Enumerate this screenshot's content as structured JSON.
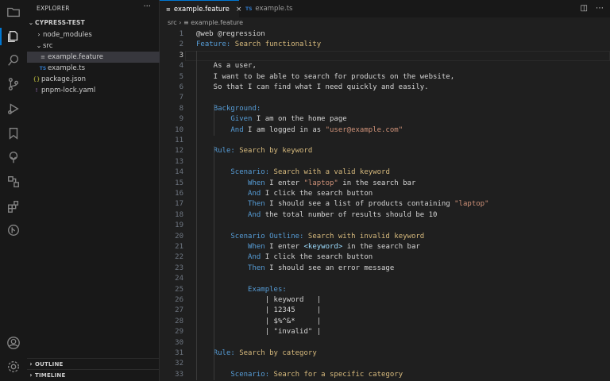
{
  "sidebar": {
    "title": "EXPLORER",
    "more": "···",
    "project": "CYPRESS-TEST",
    "tree": [
      {
        "name": "node_modules",
        "kind": "folder",
        "depth": 1,
        "icon": "chevron-right-icon"
      },
      {
        "name": "src",
        "kind": "folder-open",
        "depth": 1,
        "icon": "chevron-down-icon"
      },
      {
        "name": "example.feature",
        "kind": "feature",
        "depth": 2,
        "icon": "feature-file-icon",
        "selected": true
      },
      {
        "name": "example.ts",
        "kind": "ts",
        "depth": 2,
        "icon": "ts-file-icon"
      },
      {
        "name": "package.json",
        "kind": "json",
        "depth": 1,
        "icon": "json-file-icon"
      },
      {
        "name": "pnpm-lock.yaml",
        "kind": "yaml",
        "depth": 1,
        "icon": "yaml-file-icon"
      }
    ],
    "outline": "OUTLINE",
    "timeline": "TIMELINE"
  },
  "tabs": [
    {
      "label": "example.feature",
      "active": true,
      "icon": "≡",
      "close": "×"
    },
    {
      "label": "example.ts",
      "active": false,
      "icon": "TS"
    }
  ],
  "breadcrumb": {
    "root": "src",
    "separator": "›",
    "icon": "≡",
    "file": "example.feature"
  },
  "editor": {
    "current_line": 3,
    "lines": [
      [
        [
          "@web @regression",
          "k-txt"
        ]
      ],
      [
        [
          "Feature:",
          "k-kw"
        ],
        [
          " Search functionality",
          "k-key"
        ]
      ],
      [],
      [
        [
          "    As a user,",
          "k-txt"
        ]
      ],
      [
        [
          "    I want to be able to search for products on the website,",
          "k-txt"
        ]
      ],
      [
        [
          "    So that I can find what I need quickly and easily.",
          "k-txt"
        ]
      ],
      [],
      [
        [
          "    ",
          "k-txt"
        ],
        [
          "Background:",
          "k-kw"
        ]
      ],
      [
        [
          "        ",
          "k-txt"
        ],
        [
          "Given",
          "k-kw"
        ],
        [
          " I am on the home page",
          "k-txt"
        ]
      ],
      [
        [
          "        ",
          "k-txt"
        ],
        [
          "And",
          "k-kw"
        ],
        [
          " I am logged in as ",
          "k-txt"
        ],
        [
          "\"user@example.com\"",
          "k-str"
        ]
      ],
      [],
      [
        [
          "    ",
          "k-txt"
        ],
        [
          "Rule:",
          "k-kw"
        ],
        [
          " Search by keyword",
          "k-key"
        ]
      ],
      [],
      [
        [
          "        ",
          "k-txt"
        ],
        [
          "Scenario:",
          "k-kw"
        ],
        [
          " Search with a valid keyword",
          "k-key"
        ]
      ],
      [
        [
          "            ",
          "k-txt"
        ],
        [
          "When",
          "k-kw"
        ],
        [
          " I enter ",
          "k-txt"
        ],
        [
          "\"laptop\"",
          "k-str"
        ],
        [
          " in the search bar",
          "k-txt"
        ]
      ],
      [
        [
          "            ",
          "k-txt"
        ],
        [
          "And",
          "k-kw"
        ],
        [
          " I click the search button",
          "k-txt"
        ]
      ],
      [
        [
          "            ",
          "k-txt"
        ],
        [
          "Then",
          "k-kw"
        ],
        [
          " I should see a list of products containing ",
          "k-txt"
        ],
        [
          "\"laptop\"",
          "k-str"
        ]
      ],
      [
        [
          "            ",
          "k-txt"
        ],
        [
          "And",
          "k-kw"
        ],
        [
          " the total number of results should be 10",
          "k-txt"
        ]
      ],
      [],
      [
        [
          "        ",
          "k-txt"
        ],
        [
          "Scenario Outline:",
          "k-kw"
        ],
        [
          " Search with invalid keyword",
          "k-key"
        ]
      ],
      [
        [
          "            ",
          "k-txt"
        ],
        [
          "When",
          "k-kw"
        ],
        [
          " I enter ",
          "k-txt"
        ],
        [
          "<keyword>",
          "k-var"
        ],
        [
          " in the search bar",
          "k-txt"
        ]
      ],
      [
        [
          "            ",
          "k-txt"
        ],
        [
          "And",
          "k-kw"
        ],
        [
          " I click the search button",
          "k-txt"
        ]
      ],
      [
        [
          "            ",
          "k-txt"
        ],
        [
          "Then",
          "k-kw"
        ],
        [
          " I should see an error message",
          "k-txt"
        ]
      ],
      [],
      [
        [
          "            ",
          "k-txt"
        ],
        [
          "Examples:",
          "k-kw"
        ]
      ],
      [
        [
          "                | keyword   |",
          "k-txt"
        ]
      ],
      [
        [
          "                | 12345     |",
          "k-txt"
        ]
      ],
      [
        [
          "                | $%^&*     |",
          "k-txt"
        ]
      ],
      [
        [
          "                | \"invalid\" |",
          "k-txt"
        ]
      ],
      [],
      [
        [
          "    ",
          "k-txt"
        ],
        [
          "Rule:",
          "k-kw"
        ],
        [
          " Search by category",
          "k-key"
        ]
      ],
      [],
      [
        [
          "        ",
          "k-txt"
        ],
        [
          "Scenario:",
          "k-kw"
        ],
        [
          " Search for a specific category",
          "k-key"
        ]
      ]
    ]
  },
  "colors": {
    "accent": "#0078d4",
    "editor_bg": "#1f1f1f",
    "sidebar_bg": "#181818"
  }
}
